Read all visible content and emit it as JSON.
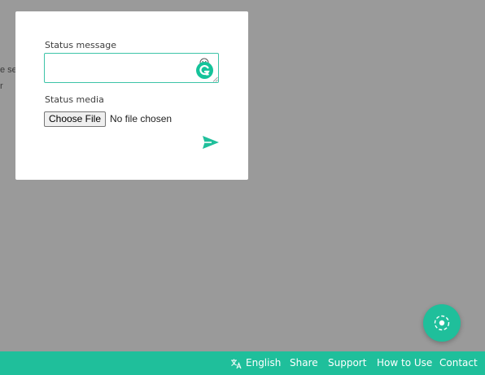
{
  "background": {
    "partial_text_line1": "e se",
    "partial_text_line2": "r"
  },
  "modal": {
    "status_message_label": "Status message",
    "status_message_value": "",
    "status_media_label": "Status media",
    "choose_file_label": "Choose File",
    "file_status": "No file chosen"
  },
  "footer": {
    "language_label": "English",
    "share_label": "Share",
    "support_label": "Support",
    "how_to_use_label": "How to Use",
    "contact_label": "Contact"
  },
  "colors": {
    "accent": "#1fbf9b",
    "overlay": "#9a9a9a",
    "input_border": "#3dc4a8"
  },
  "icons": {
    "send": "send-icon",
    "grammarly": "grammarly-icon",
    "emoji": "emoji-icon",
    "language": "translate-icon",
    "fab": "target-icon"
  }
}
